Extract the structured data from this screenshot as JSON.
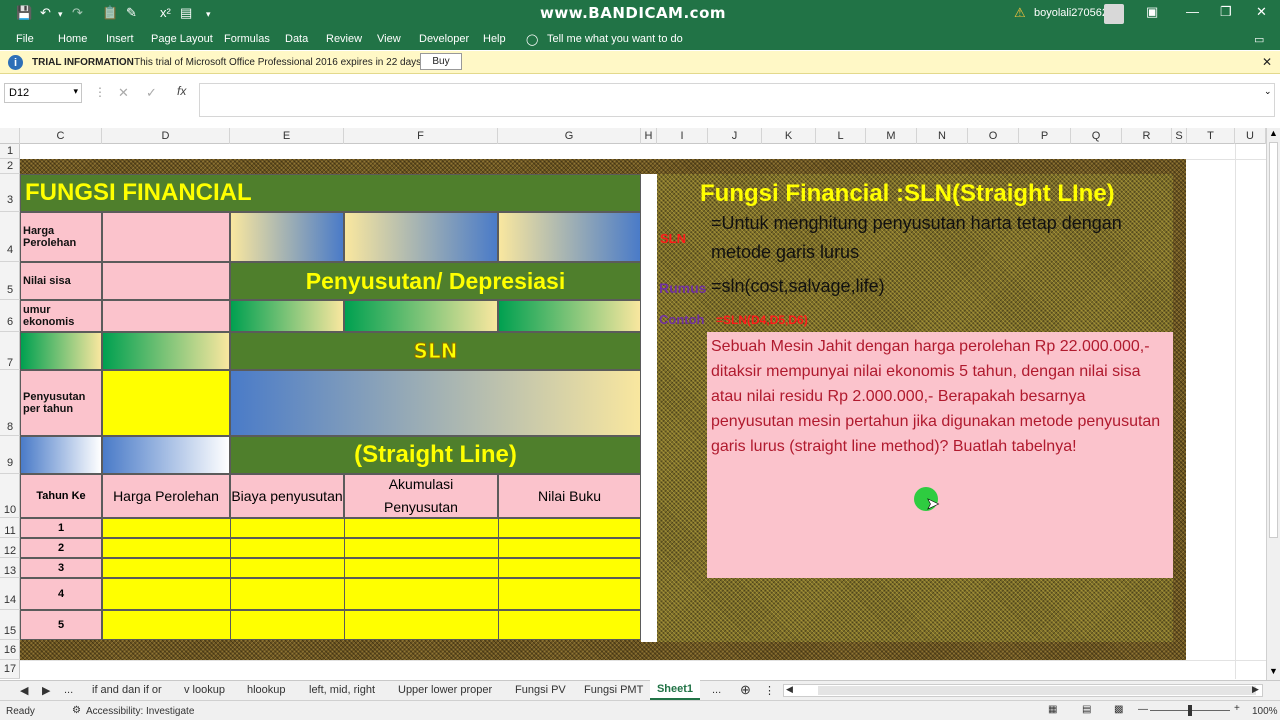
{
  "titlebar": {
    "watermark": "www.BANDICAM.com",
    "user": "boyolali270562",
    "warning_icon": "warning-icon",
    "accent": "#217346"
  },
  "ribbon": {
    "tabs": [
      "File",
      "Home",
      "Insert",
      "Page Layout",
      "Formulas",
      "Data",
      "Review",
      "View",
      "Developer",
      "Help"
    ],
    "tell_me": "Tell me what you want to do"
  },
  "trial": {
    "title": "TRIAL INFORMATION",
    "message": "This trial of Microsoft Office Professional 2016 expires in 22 days.",
    "buy": "Buy"
  },
  "formula_bar": {
    "name_box": "D12",
    "fx": "fx",
    "value": ""
  },
  "columns": [
    "C",
    "D",
    "E",
    "F",
    "G",
    "H",
    "I",
    "J",
    "K",
    "L",
    "M",
    "N",
    "O",
    "P",
    "Q",
    "R",
    "S",
    "T",
    "U"
  ],
  "rows": [
    "1",
    "2",
    "3",
    "4",
    "5",
    "6",
    "7",
    "8",
    "9",
    "10",
    "11",
    "12",
    "13",
    "14",
    "15",
    "16",
    "17"
  ],
  "left_table": {
    "title": "FUNGSI FINANCIAL",
    "harga_perolehan": "Harga Perolehan",
    "nilai_sisa": "Nilai sisa",
    "umur_ekonomis": "umur ekonomis",
    "penyusutan_per_tahun": "Penyusutan per tahun",
    "penyusutan_heading": "Penyusutan/ Depresiasi",
    "sln_heading": "SLN",
    "straight_line": "(Straight Line)",
    "headers": [
      "Tahun Ke",
      "Harga Perolehan",
      "Biaya penyusutan",
      "Akumulasi Penyusutan",
      "Nilai Buku"
    ],
    "years": [
      "1",
      "2",
      "3",
      "4",
      "5"
    ]
  },
  "right_panel": {
    "title": "Fungsi Financial :SLN(Straight LIne)",
    "sln_label": "SLN",
    "sln_desc": "=Untuk menghitung penyusutan harta tetap dengan metode garis lurus",
    "rumus_label": "Rumus",
    "rumus_value": "=sln(cost,salvage,life)",
    "contoh_label": "Contoh",
    "contoh_value": "=SLN(D4,D5,D6)",
    "problem": "Sebuah Mesin Jahit dengan harga perolehan Rp 22.000.000,- ditaksir mempunyai nilai ekonomis 5 tahun, dengan nilai sisa atau  nilai residu Rp 2.000.000,- Berapakah besarnya penyusutan mesin pertahun jika digunakan metode penyusutan garis lurus (straight line method)? Buatlah tabelnya!"
  },
  "sheet_tabs": [
    "...",
    "if and dan if or",
    "v lookup",
    "hlookup",
    "left, mid, right",
    "Upper lower proper",
    "Fungsi PV",
    "Fungsi PMT",
    "Sheet1",
    "..."
  ],
  "active_sheet": "Sheet1",
  "status": {
    "ready": "Ready",
    "accessibility": "Accessibility: Investigate",
    "zoom": "100%"
  }
}
